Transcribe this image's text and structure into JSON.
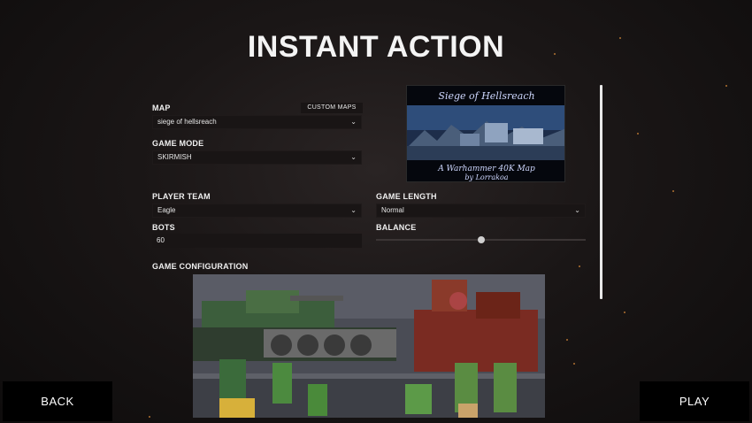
{
  "page": {
    "title": "INSTANT ACTION"
  },
  "map": {
    "label": "MAP",
    "value": "siege of hellsreach",
    "custom_maps_label": "CUSTOM MAPS",
    "preview": {
      "title": "Siege of Hellsreach",
      "subtitle_line1": "A Warhammer 40K Map",
      "subtitle_line2": "by Lorrakoa"
    }
  },
  "game_mode": {
    "label": "GAME MODE",
    "value": "SKIRMISH"
  },
  "player_team": {
    "label": "PLAYER TEAM",
    "value": "Eagle"
  },
  "game_length": {
    "label": "GAME LENGTH",
    "value": "Normal"
  },
  "bots": {
    "label": "BOTS",
    "value": "60"
  },
  "balance": {
    "label": "BALANCE",
    "level": 0.5
  },
  "game_configuration": {
    "label": "GAME CONFIGURATION"
  },
  "buttons": {
    "back": "BACK",
    "play": "PLAY"
  },
  "icons": {
    "dropdown": "chevron-down-icon"
  },
  "colors": {
    "background": "#1a1616",
    "field": "#191515",
    "button": "#000000",
    "text": "#f0f0f0"
  }
}
